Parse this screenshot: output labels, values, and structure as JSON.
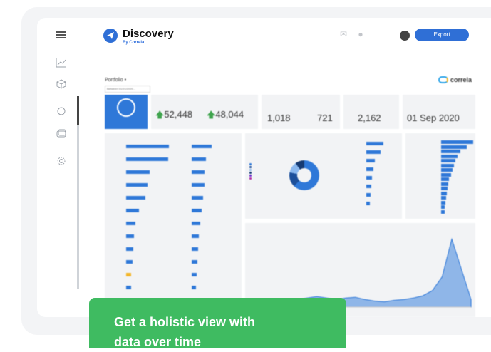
{
  "app": {
    "name": "Discovery",
    "by_line": "By Correla",
    "export_label": "Export"
  },
  "sidebar": {
    "icons": [
      "menu-icon",
      "chart-icon",
      "cube-icon",
      "circle-icon",
      "layers-icon",
      "settings-icon"
    ]
  },
  "dashboard": {
    "title": "Portfolio •",
    "filter": "Between 01/01/2020...",
    "brand": "correla",
    "kpis": [
      {
        "value": "52,448",
        "trend": "up"
      },
      {
        "value": "48,044",
        "trend": "up"
      },
      {
        "value": "1,018"
      },
      {
        "value": "721"
      },
      {
        "value": "2,162"
      },
      {
        "value": "01 Sep 2020"
      }
    ],
    "bars_left": [
      1,
      0.98,
      0.55,
      0.5,
      0.45,
      0.3,
      0.22,
      0.18,
      0.16,
      0.15,
      0.12,
      0.12,
      0.11,
      0.1
    ],
    "bars_right": [
      0.7,
      0.5,
      0.45,
      0.44,
      0.4,
      0.35,
      0.3,
      0.25,
      0.22,
      0.2,
      0.18,
      0.16,
      0.15,
      0.12
    ],
    "hbars_right": [
      0.6,
      0.5,
      0.3,
      0.25,
      0.2,
      0.18,
      0.14,
      0.12
    ],
    "hbars_far": [
      1,
      0.8,
      0.6,
      0.5,
      0.45,
      0.4,
      0.35,
      0.3,
      0.25,
      0.22,
      0.2,
      0.18,
      0.16,
      0.14,
      0.12,
      0.1
    ],
    "area_series": [
      0.02,
      0.03,
      0.05,
      0.06,
      0.08,
      0.1,
      0.12,
      0.14,
      0.12,
      0.1,
      0.12,
      0.13,
      0.1,
      0.08,
      0.07,
      0.09,
      0.1,
      0.12,
      0.15,
      0.22,
      0.4,
      0.9,
      0.5,
      0.1
    ]
  },
  "callout": {
    "line1": "Get a holistic view with",
    "line2": "data over time"
  },
  "colors": {
    "accent": "#2f78d8",
    "callout": "#3fbb61",
    "up": "#3fa34d"
  }
}
